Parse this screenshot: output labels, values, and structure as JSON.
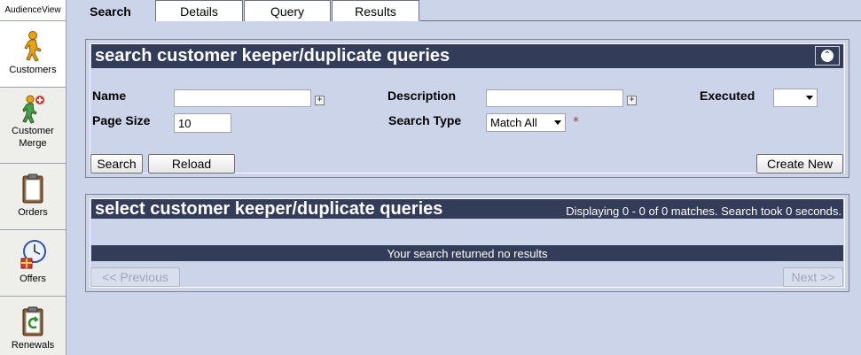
{
  "sidebar": {
    "brand": "AudienceView",
    "items": [
      {
        "label": "Customers",
        "icon": "person-walking-icon"
      },
      {
        "label": "Customer\nMerge",
        "icon": "customer-merge-icon"
      },
      {
        "label": "Orders",
        "icon": "clipboard-icon"
      },
      {
        "label": "Offers",
        "icon": "clock-gift-icon"
      },
      {
        "label": "Renewals",
        "icon": "renewal-clipboard-icon"
      }
    ]
  },
  "tabs": [
    "Search",
    "Details",
    "Query",
    "Results"
  ],
  "search_panel": {
    "title": "search customer keeper/duplicate queries",
    "fields": {
      "name_label": "Name",
      "name_value": "",
      "description_label": "Description",
      "description_value": "",
      "executed_label": "Executed",
      "executed_value": "",
      "page_size_label": "Page Size",
      "page_size_value": "10",
      "search_type_label": "Search Type",
      "search_type_value": "Match All",
      "required_marker": "*"
    },
    "buttons": {
      "search": "Search",
      "reload": "Reload",
      "create_new": "Create New"
    }
  },
  "results_panel": {
    "title": "select customer keeper/duplicate queries",
    "status": "Displaying 0 - 0 of 0 matches. Search took 0 seconds.",
    "no_results": "Your search returned no results",
    "previous": "<< Previous",
    "next": "Next >>"
  },
  "colors": {
    "background": "#ccd4ea",
    "header": "#333d59",
    "required": "#e0242b"
  }
}
